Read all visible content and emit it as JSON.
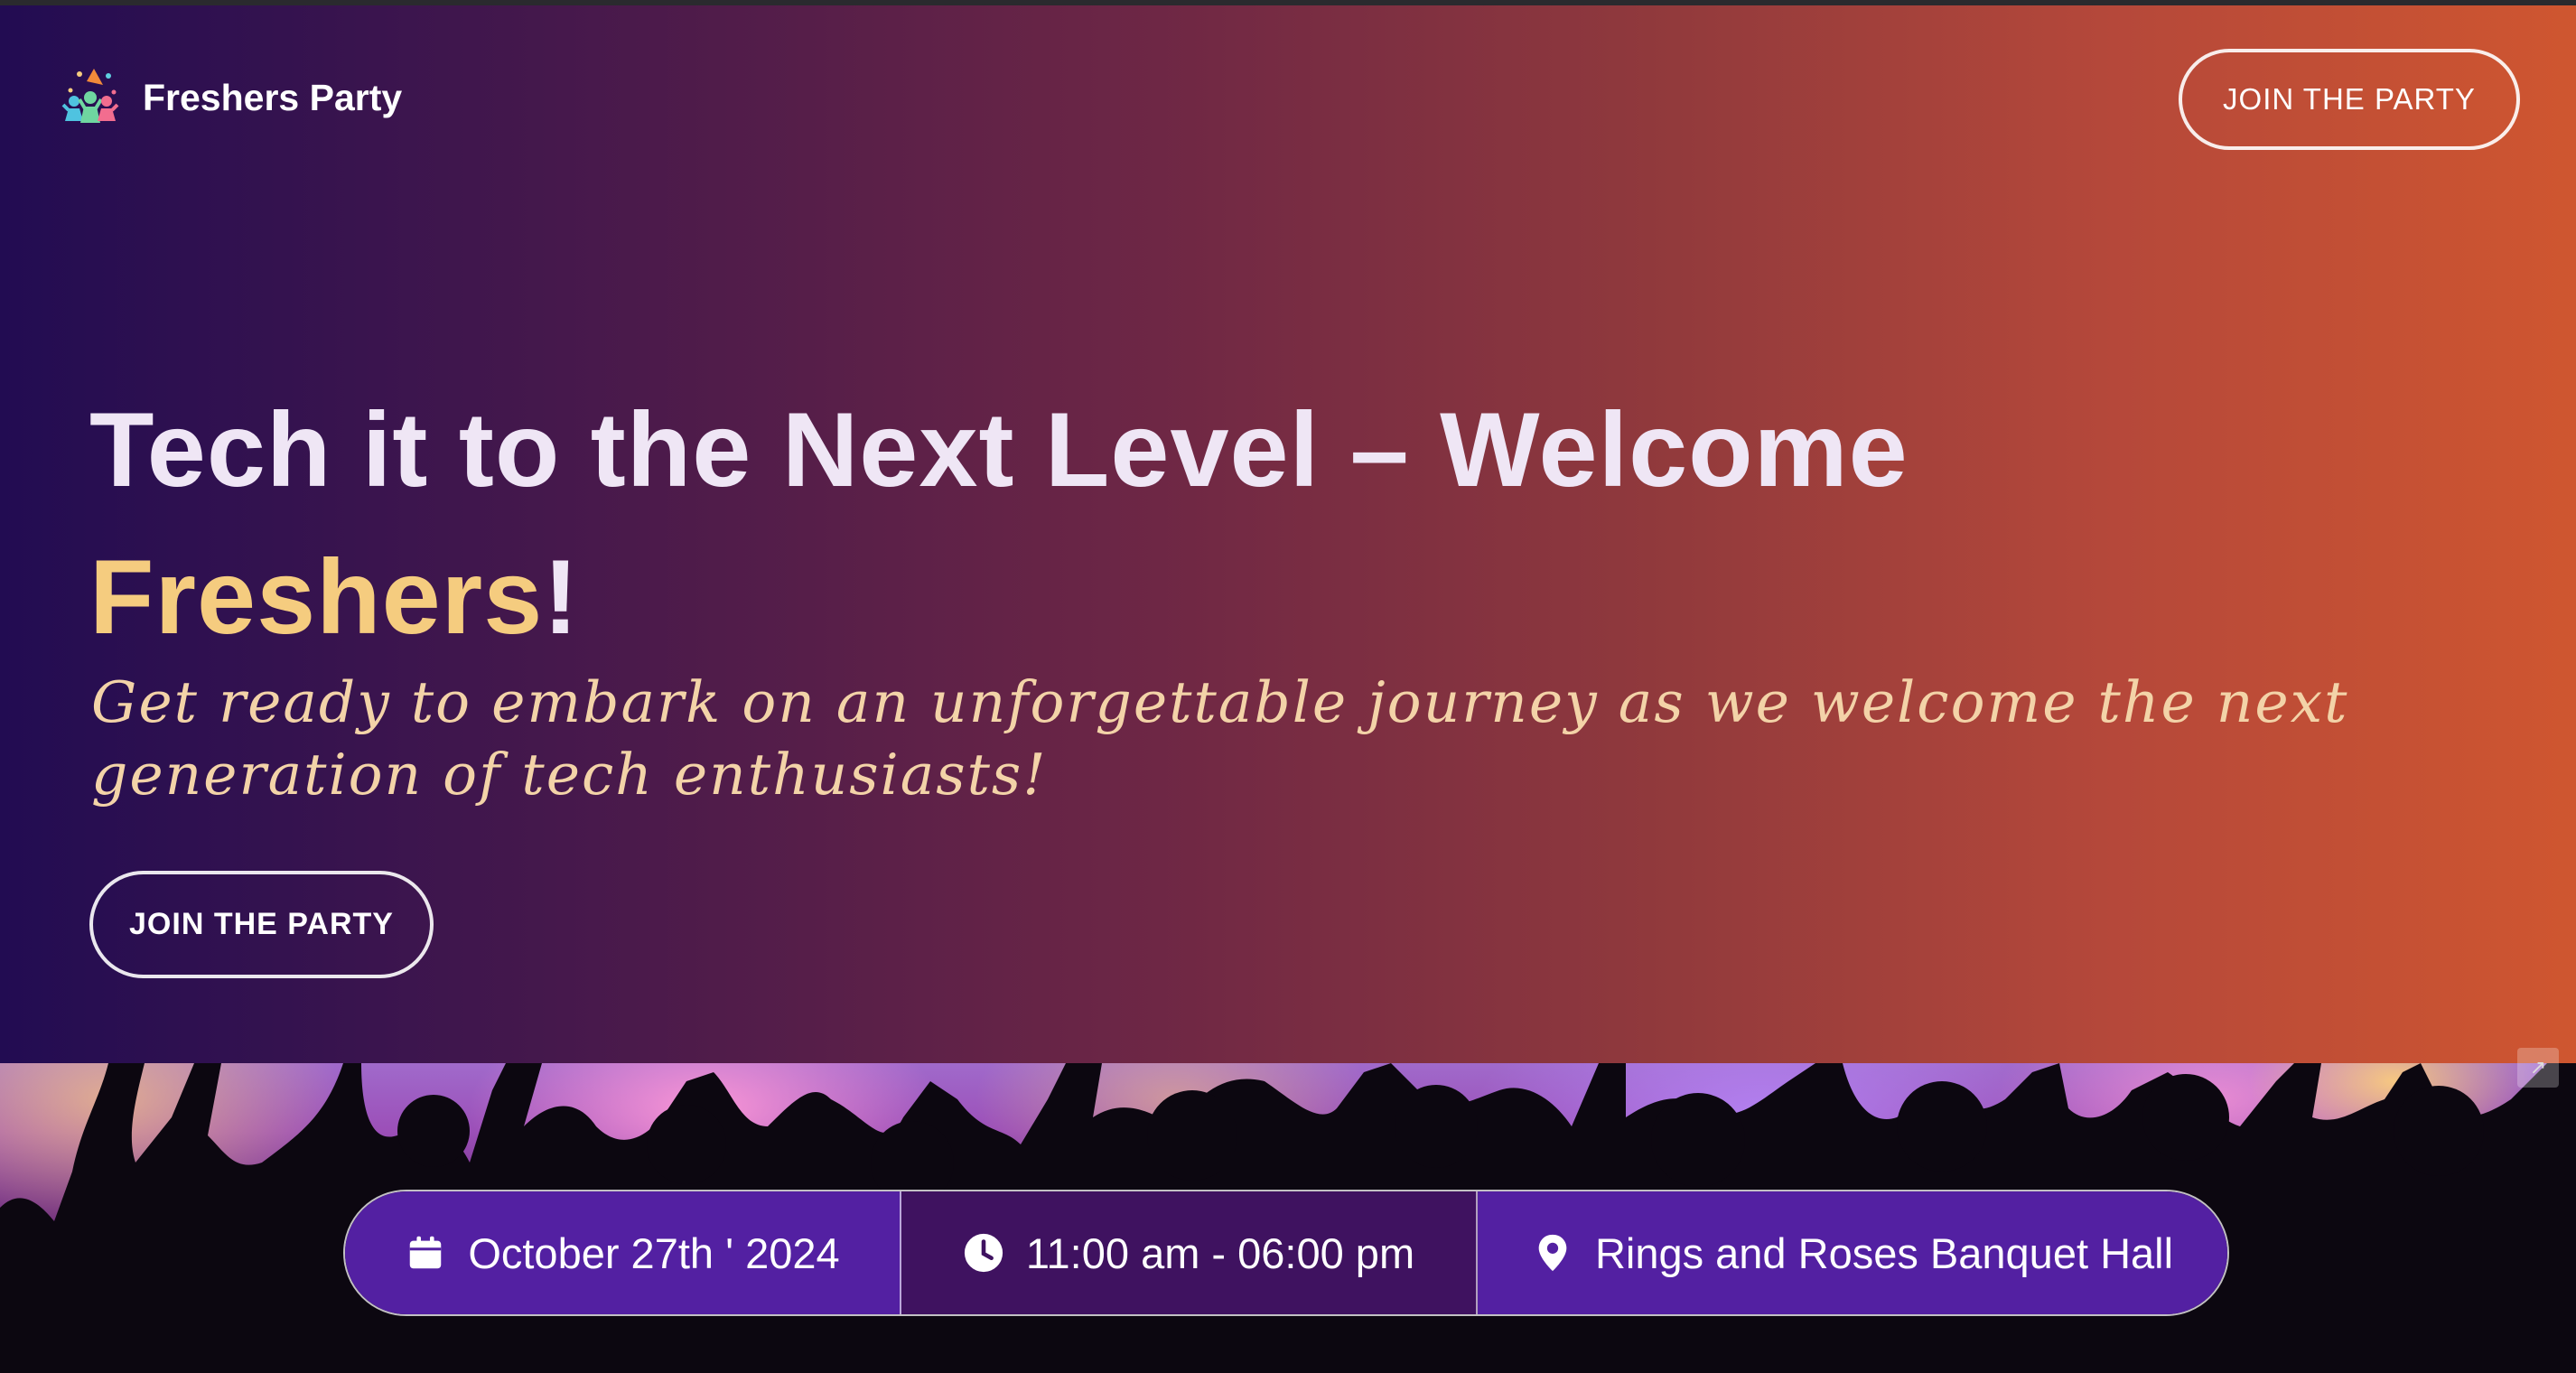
{
  "header": {
    "brand_name": "Freshers Party",
    "logo_icon": "celebration-people-icon",
    "join_button": "JOIN THE PARTY"
  },
  "hero": {
    "headline_main": "Tech it to the Next Level – Welcome",
    "headline_accent": "Freshers",
    "headline_end": "!",
    "subtitle": "Get ready to embark on an unforgettable journey as we welcome the next generation of tech enthusiasts!",
    "cta_button": "JOIN THE PARTY"
  },
  "event": {
    "date": "October 27th ' 2024",
    "time": "11:00 am - 06:00 pm",
    "venue": "Rings and Roses Banquet Hall"
  },
  "colors": {
    "gradient_start": "#220c52",
    "gradient_end": "#cf5630",
    "headline": "#efe6f5",
    "accent": "#f5cc7f",
    "subtitle": "#f3d3a8",
    "info_bar_purple": "#5320a2",
    "info_bar_dark": "#3f1260"
  }
}
